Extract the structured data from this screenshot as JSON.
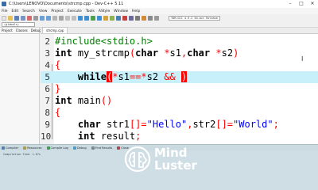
{
  "window": {
    "title": "C:\\Users\\LENOVO\\Documents\\strcmp.cpp - Dev-C++ 5.11",
    "controls": [
      "–",
      "□",
      "✕"
    ]
  },
  "menu": {
    "items": [
      "File",
      "Edit",
      "Search",
      "View",
      "Project",
      "Execute",
      "Tools",
      "AStyle",
      "Window",
      "Help"
    ]
  },
  "toolbar": {
    "compiler_select": "TDM-GCC 4.9.2 64-bit Release",
    "scope_select": "(globals)"
  },
  "left_panel": {
    "tabs": [
      "Project",
      "Classes",
      "Debug"
    ]
  },
  "editor": {
    "file_tab": "strcmp.cpp",
    "current_line": 5,
    "lines": [
      {
        "n": "2",
        "t": [
          {
            "c": "pp",
            "v": "#include<stdio.h>"
          }
        ]
      },
      {
        "n": "3",
        "t": [
          {
            "c": "kw",
            "v": "int"
          },
          {
            "c": "",
            "v": " my_strcmp"
          },
          {
            "c": "op",
            "v": "("
          },
          {
            "c": "kw",
            "v": "char"
          },
          {
            "c": "",
            "v": " "
          },
          {
            "c": "op",
            "v": "*"
          },
          {
            "c": "",
            "v": "s1"
          },
          {
            "c": "op",
            "v": ","
          },
          {
            "c": "kw",
            "v": "char"
          },
          {
            "c": "",
            "v": " "
          },
          {
            "c": "op",
            "v": "*"
          },
          {
            "c": "",
            "v": "s2"
          },
          {
            "c": "op",
            "v": ")"
          }
        ]
      },
      {
        "n": "4",
        "t": [
          {
            "c": "br",
            "v": "{"
          }
        ]
      },
      {
        "n": "5",
        "t": [
          {
            "c": "",
            "v": "    "
          },
          {
            "c": "kw",
            "v": "while"
          },
          {
            "c": "hl",
            "v": "("
          },
          {
            "c": "op",
            "v": "*"
          },
          {
            "c": "",
            "v": "s1"
          },
          {
            "c": "op",
            "v": "=="
          },
          {
            "c": "op",
            "v": "*"
          },
          {
            "c": "",
            "v": "s2 "
          },
          {
            "c": "op",
            "v": "&&"
          },
          {
            "c": "",
            "v": " "
          },
          {
            "c": "hl",
            "v": ")"
          }
        ]
      },
      {
        "n": "6",
        "t": [
          {
            "c": "br",
            "v": "}"
          }
        ]
      },
      {
        "n": "7",
        "t": [
          {
            "c": "kw",
            "v": "int"
          },
          {
            "c": "",
            "v": " main"
          },
          {
            "c": "op",
            "v": "()"
          }
        ]
      },
      {
        "n": "8",
        "t": [
          {
            "c": "br",
            "v": "{"
          }
        ]
      },
      {
        "n": "9",
        "t": [
          {
            "c": "",
            "v": "    "
          },
          {
            "c": "kw",
            "v": "char"
          },
          {
            "c": "",
            "v": " str1"
          },
          {
            "c": "op",
            "v": "[]="
          },
          {
            "c": "str",
            "v": "\"Hello\""
          },
          {
            "c": "op",
            "v": ","
          },
          {
            "c": "",
            "v": "str2"
          },
          {
            "c": "op",
            "v": "[]="
          },
          {
            "c": "str",
            "v": "\"World\""
          },
          {
            "c": "op",
            "v": ";"
          }
        ]
      },
      {
        "n": "10",
        "t": [
          {
            "c": "",
            "v": "    "
          },
          {
            "c": "kw",
            "v": "int"
          },
          {
            "c": "",
            "v": " result"
          },
          {
            "c": "op",
            "v": ";"
          }
        ]
      }
    ]
  },
  "bottom_panel": {
    "tabs": [
      {
        "label": "Compiler",
        "color": "#5a7fb0"
      },
      {
        "label": "Resources",
        "color": "#c9a33a"
      },
      {
        "label": "Compile Log",
        "color": "#4aa04a"
      },
      {
        "label": "Debug",
        "color": "#5aa0c8"
      },
      {
        "label": "Find Results",
        "color": "#8a8a8a"
      },
      {
        "label": "Close",
        "color": "#c04040"
      }
    ],
    "log_text": "Compilation Time: 1.67s"
  },
  "watermark": {
    "line1": "Mind",
    "line2": "Luster",
    "logo_icon": "brain-icon"
  }
}
